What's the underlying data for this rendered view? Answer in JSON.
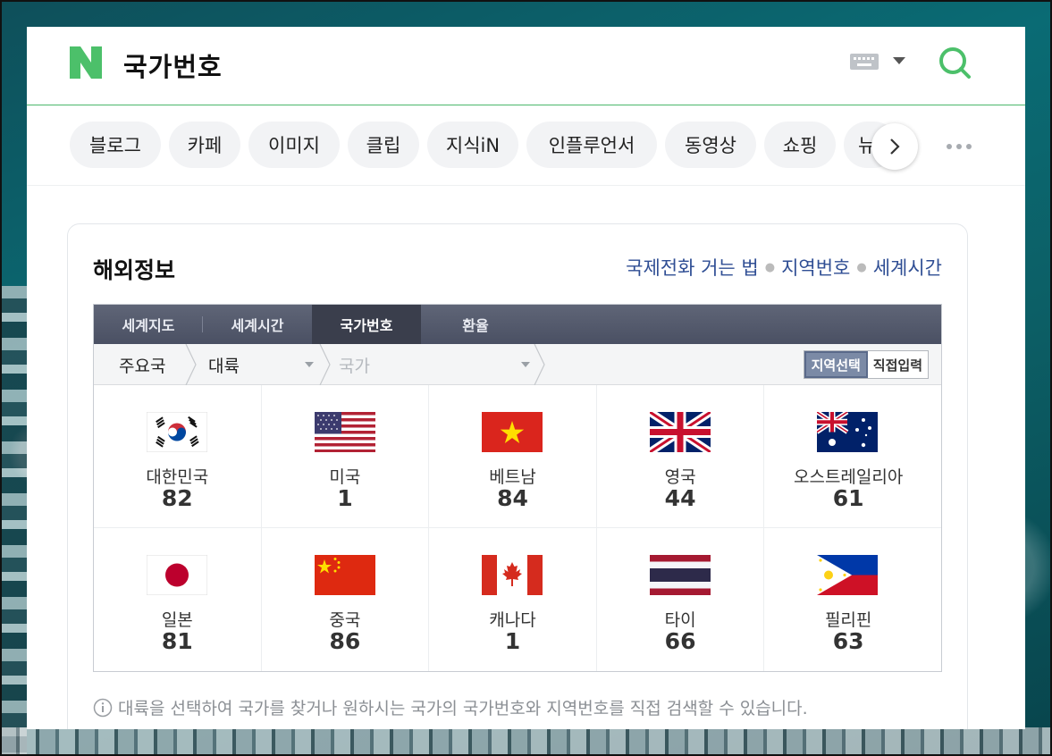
{
  "search": {
    "query": "국가번호"
  },
  "tabs": [
    {
      "label": "블로그"
    },
    {
      "label": "카페"
    },
    {
      "label": "이미지"
    },
    {
      "label": "클립"
    },
    {
      "label": "지식iN"
    },
    {
      "label": "인플루언서"
    },
    {
      "label": "동영상"
    },
    {
      "label": "쇼핑"
    },
    {
      "label": "뉴"
    }
  ],
  "card": {
    "title": "해외정보",
    "links": [
      "국제전화 거는 법",
      "지역번호",
      "세계시간"
    ]
  },
  "widget": {
    "tabs": [
      "세계지도",
      "세계시간",
      "국가번호",
      "환율"
    ],
    "active_tab": "국가번호",
    "filter": {
      "major": "주요국",
      "continent": "대륙",
      "country_placeholder": "국가"
    },
    "mode_toggle": {
      "selected": "지역선택",
      "other": "직접입력"
    },
    "countries": [
      {
        "name": "대한민국",
        "code": "82",
        "flag": "kr"
      },
      {
        "name": "미국",
        "code": "1",
        "flag": "us"
      },
      {
        "name": "베트남",
        "code": "84",
        "flag": "vn"
      },
      {
        "name": "영국",
        "code": "44",
        "flag": "gb"
      },
      {
        "name": "오스트레일리아",
        "code": "61",
        "flag": "au"
      },
      {
        "name": "일본",
        "code": "81",
        "flag": "jp"
      },
      {
        "name": "중국",
        "code": "86",
        "flag": "cn"
      },
      {
        "name": "캐나다",
        "code": "1",
        "flag": "ca"
      },
      {
        "name": "타이",
        "code": "66",
        "flag": "th"
      },
      {
        "name": "필리핀",
        "code": "63",
        "flag": "ph"
      }
    ]
  },
  "hint": "대륙을 선택하여 국가를 찾거나 원하시는 국가의 국가번호와 지역번호를 직접 검색할 수 있습니다.",
  "colors": {
    "brand_green": "#03c75a",
    "link_blue": "#2f4e94",
    "tab_bar": "#4a5063"
  }
}
